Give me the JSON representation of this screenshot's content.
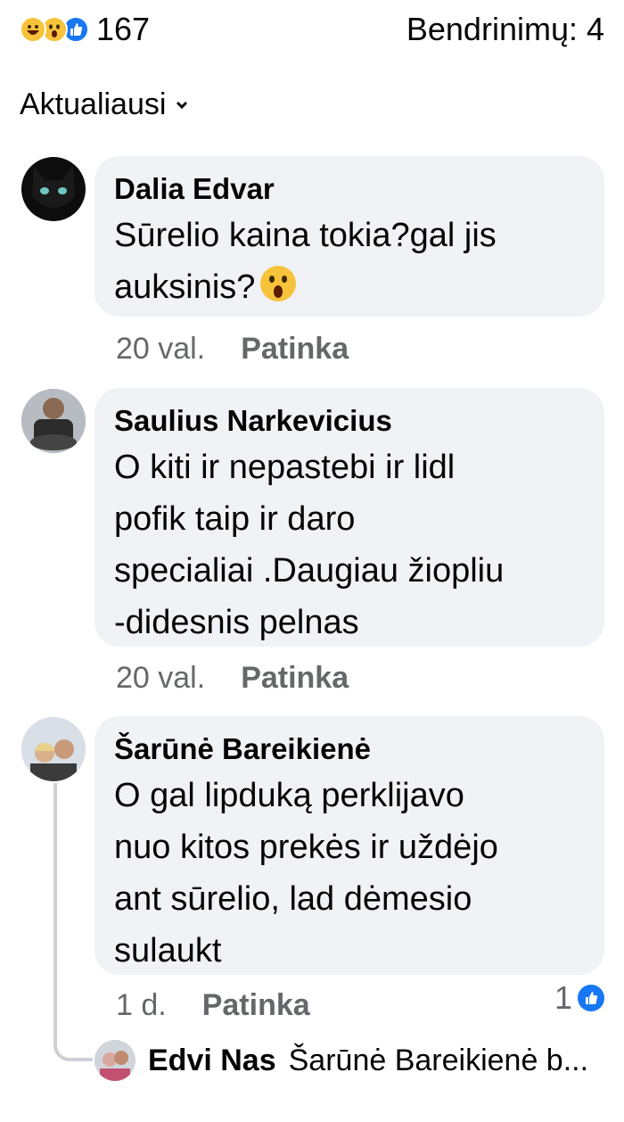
{
  "header": {
    "reaction_icons": [
      "haha-reaction-icon",
      "wow-reaction-icon",
      "like-reaction-icon"
    ],
    "reaction_count": "167",
    "shares": "Bendrinimų: 4"
  },
  "sort": {
    "label": "Aktualiausi",
    "icon": "chevron-down-icon"
  },
  "comments": [
    {
      "author": "Dalia Edvar",
      "text": "Sūrelio kaina tokia?gal jis\nauksinis?",
      "emoji": "wow-emoji-icon",
      "time": "20 val.",
      "like_label": "Patinka"
    },
    {
      "author": "Saulius Narkevicius",
      "text": "O kiti ir nepastebi ir lidl\npofik taip ir daro\nspecialiai .Daugiau žiopliu\n-didesnis pelnas",
      "time": "20 val.",
      "like_label": "Patinka"
    },
    {
      "author": "Šarūnė Bareikienė",
      "text": "O gal lipduką perklijavo\nnuo kitos prekės ir uždėjo\nant sūrelio, lad dėmesio\nsulaukt",
      "time": "1 d.",
      "like_label": "Patinka",
      "likes": "1"
    }
  ],
  "reply": {
    "author": "Edvi Nas",
    "preview": "Šarūnė Bareikienė b..."
  },
  "colors": {
    "accent": "#1877f2",
    "bubble": "#f0f2f5",
    "meta": "#65676b"
  }
}
